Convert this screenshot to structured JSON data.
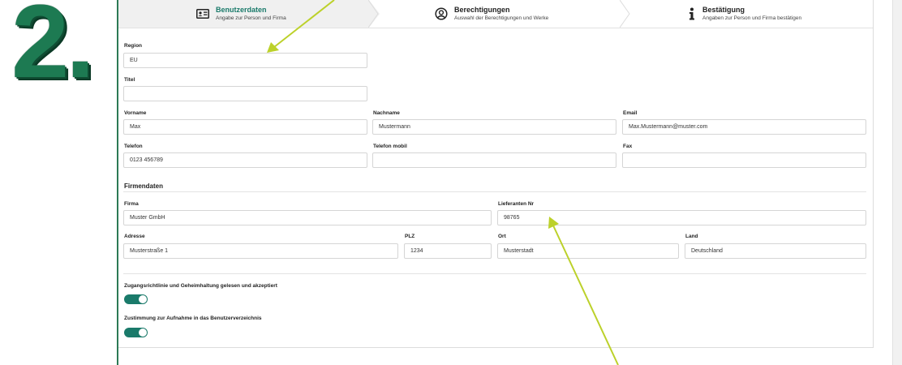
{
  "step_number": "2.",
  "stepper": {
    "steps": [
      {
        "title": "Benutzerdaten",
        "subtitle": "Angabe zur Person und Firma",
        "icon": "id-card-icon",
        "active": true
      },
      {
        "title": "Berechtigungen",
        "subtitle": "Auswahl der Berechtigungen und Werke",
        "icon": "user-circle-icon",
        "active": false
      },
      {
        "title": "Bestätigung",
        "subtitle": "Angaben zur Person und Firma bestätigen",
        "icon": "info-icon",
        "active": false
      }
    ]
  },
  "user": {
    "region": {
      "label": "Region",
      "value": "EU"
    },
    "titel": {
      "label": "Titel",
      "value": ""
    },
    "vorname": {
      "label": "Vorname",
      "value": "Max"
    },
    "nachname": {
      "label": "Nachname",
      "value": "Mustermann"
    },
    "email": {
      "label": "Email",
      "value": "Max.Mustermann@muster.com"
    },
    "telefon": {
      "label": "Telefon",
      "value": "0123 456789"
    },
    "telefon_mobil": {
      "label": "Telefon mobil",
      "value": ""
    },
    "fax": {
      "label": "Fax",
      "value": ""
    }
  },
  "company": {
    "section_title": "Firmendaten",
    "firma": {
      "label": "Firma",
      "value": "Muster GmbH"
    },
    "lieferanten_nr": {
      "label": "Lieferanten Nr",
      "value": "98765"
    },
    "adresse": {
      "label": "Adresse",
      "value": "Musterstraße 1"
    },
    "plz": {
      "label": "PLZ",
      "value": "1234"
    },
    "ort": {
      "label": "Ort",
      "value": "Musterstadt"
    },
    "land": {
      "label": "Land",
      "value": "Deutschland"
    }
  },
  "consents": {
    "privacy": {
      "label": "Zugangsrichtlinie und Geheimhaltung gelesen und akzeptiert",
      "on": true
    },
    "directory": {
      "label": "Zustimmung zur Aufnahme in das Benutzerverzeichnis",
      "on": true
    }
  },
  "colors": {
    "accent": "#1a7a6a",
    "annotation_arrow": "#bcd12a",
    "step_number": "#1d7a52"
  }
}
